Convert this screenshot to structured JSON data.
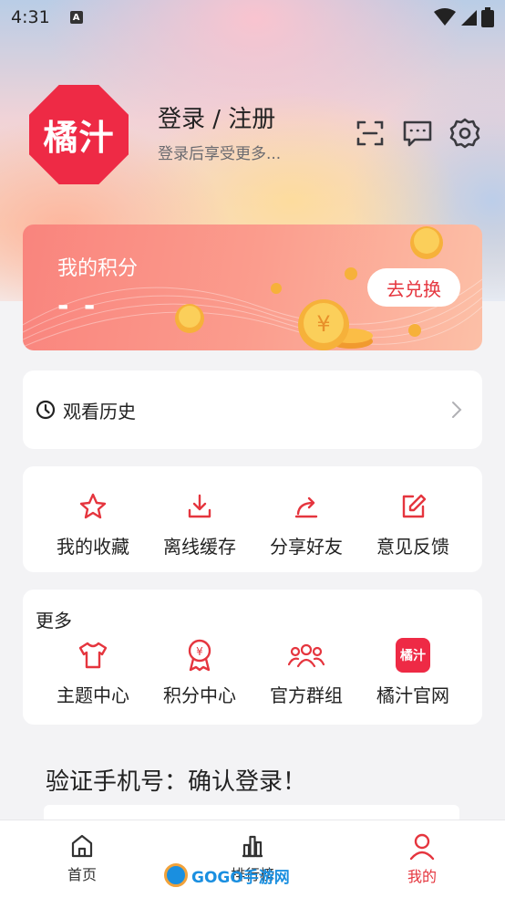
{
  "status_bar": {
    "time": "4:31",
    "notif_glyph": "A"
  },
  "profile": {
    "avatar_text": "橘汁",
    "login_title": "登录 / 注册",
    "login_subtitle": "登录后享受更多..."
  },
  "header_icons": [
    "scan-icon",
    "message-icon",
    "settings-icon"
  ],
  "points": {
    "title": "我的积分",
    "value": "- -",
    "exchange_label": "去兑换"
  },
  "history": {
    "label": "观看历史"
  },
  "quick_actions": [
    {
      "label": "我的收藏",
      "icon": "star-icon"
    },
    {
      "label": "离线缓存",
      "icon": "download-icon"
    },
    {
      "label": "分享好友",
      "icon": "share-icon"
    },
    {
      "label": "意见反馈",
      "icon": "edit-icon"
    }
  ],
  "more": {
    "title": "更多",
    "items": [
      {
        "label": "主题中心",
        "icon": "shirt-icon"
      },
      {
        "label": "积分中心",
        "icon": "badge-icon"
      },
      {
        "label": "官方群组",
        "icon": "group-icon"
      },
      {
        "label": "橘汁官网",
        "icon": "brand-icon",
        "badge_text": "橘汁"
      }
    ]
  },
  "verify_banner": "验证手机号：确认登录！",
  "tabbar": [
    {
      "label": "首页",
      "icon": "home-icon",
      "active": false
    },
    {
      "label": "排行榜",
      "icon": "chart-icon",
      "active": false
    },
    {
      "label": "我的",
      "icon": "user-icon",
      "active": true
    }
  ],
  "watermark": "GOGO手游网",
  "colors": {
    "accent": "#e5353e",
    "brand": "#ee2a45",
    "page_bg": "#f3f3f5"
  }
}
